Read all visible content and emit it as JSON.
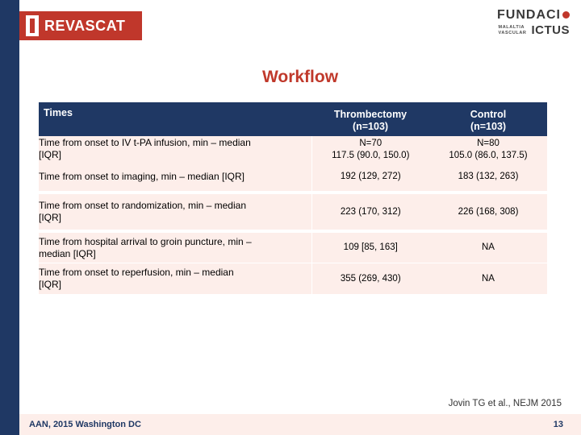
{
  "brand": {
    "revascat_word": "REVASCAT",
    "fundacio_top": "FUNDACI",
    "fundacio_small_line1": "MALALTIA",
    "fundacio_small_line2": "VASCULAR",
    "fundacio_ictus": "ICTUS"
  },
  "title": "Workflow",
  "table": {
    "headers": {
      "times": "Times",
      "thrombectomy_line1": "Thrombectomy",
      "thrombectomy_line2": "(n=103)",
      "control_line1": "Control",
      "control_line2": "(n=103)"
    },
    "rows": [
      {
        "label_line1": "Time from onset to IV t-PA infusion, min – median",
        "label_line2": "[IQR]",
        "thrombectomy_n": "N=70",
        "thrombectomy": "117.5 (90.0, 150.0)",
        "control_n": "N=80",
        "control": "105.0 (86.0, 137.5)"
      },
      {
        "label_line1": "Time from onset to imaging, min – median [IQR]",
        "label_line2": "",
        "thrombectomy": "192 (129, 272)",
        "control": "183 (132, 263)"
      },
      {
        "label_line1": "Time from onset to randomization, min – median",
        "label_line2": "[IQR]",
        "thrombectomy": "223 (170, 312)",
        "control": "226 (168, 308)"
      },
      {
        "label_line1": "Time from hospital arrival to groin puncture, min –",
        "label_line2": "median [IQR]",
        "thrombectomy": "109 [85, 163]",
        "control": "NA"
      },
      {
        "label_line1": "Time from onset to reperfusion, min – median",
        "label_line2": "[IQR]",
        "thrombectomy": "355 (269, 430)",
        "control": "NA"
      }
    ]
  },
  "citation": "Jovin TG et al., NEJM 2015",
  "footer": {
    "left": "AAN, 2015 Washington DC",
    "page": "13"
  }
}
